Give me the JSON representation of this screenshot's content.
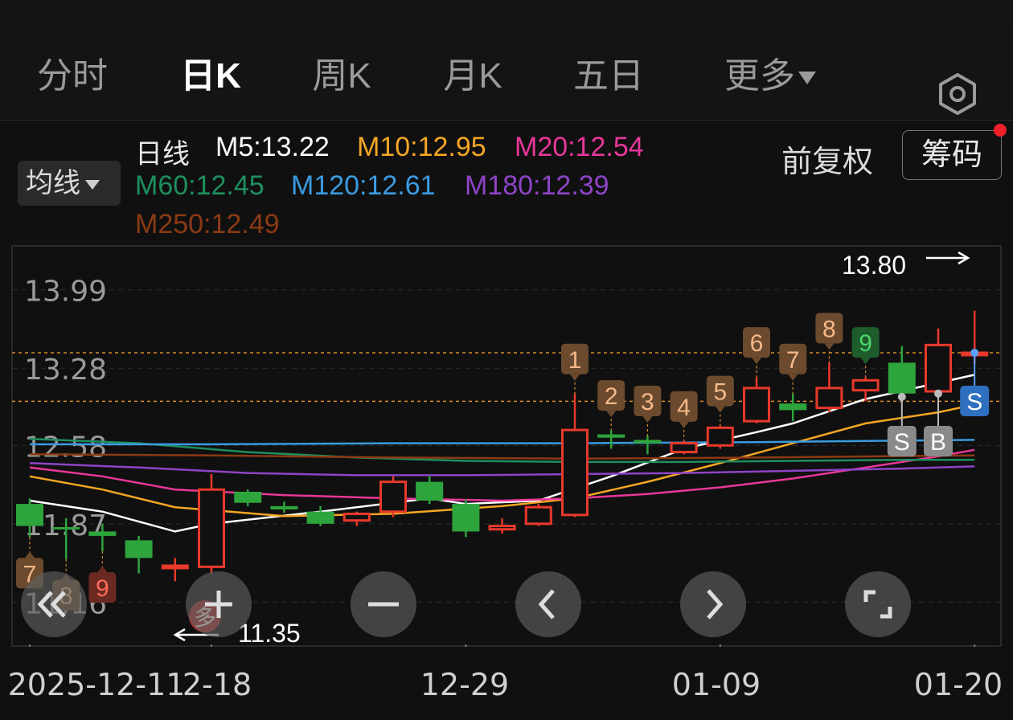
{
  "tabs": [
    {
      "label": "分时",
      "active": false
    },
    {
      "label": "日K",
      "active": true
    },
    {
      "label": "周K",
      "active": false
    },
    {
      "label": "月K",
      "active": false
    },
    {
      "label": "五日",
      "active": false
    },
    {
      "label": "更多",
      "active": false
    }
  ],
  "header": {
    "ma_button": "均线",
    "line_type": "日线",
    "adjust": "前复权",
    "chip_button": "筹码"
  },
  "ma_legend": [
    {
      "label": "M5:13.22",
      "color": "#ffffff"
    },
    {
      "label": "M10:12.95",
      "color": "#f5a623"
    },
    {
      "label": "M20:12.54",
      "color": "#e8379a"
    },
    {
      "label": "M60:12.45",
      "color": "#1e8f5e"
    },
    {
      "label": "M120:12.61",
      "color": "#3a9be0"
    },
    {
      "label": "M180:12.39",
      "color": "#8e44c6"
    },
    {
      "label": "M250:12.49",
      "color": "#8b3a14"
    }
  ],
  "colors": {
    "up": "#e8392b",
    "down": "#2ea43d",
    "bg": "#101010"
  },
  "chart_data": {
    "type": "candlestick",
    "ylim": [
      10.9,
      14.25
    ],
    "y_ticks": [
      "13.99",
      "13.28",
      "12.58",
      "11.87",
      "11.16"
    ],
    "x_labels": [
      {
        "label": "2025-12-11",
        "index": 0
      },
      {
        "label": "2-18",
        "index": 5
      },
      {
        "label": "12-29",
        "index": 12
      },
      {
        "label": "01-09",
        "index": 19
      },
      {
        "label": "01-20",
        "index": 26
      }
    ],
    "high_label": "13.80",
    "low_label": "11.35",
    "reference_lines": [
      13.42,
      12.98
    ],
    "candles": [
      {
        "o": 12.05,
        "h": 12.1,
        "l": 11.75,
        "c": 11.85
      },
      {
        "o": 11.84,
        "h": 11.92,
        "l": 11.55,
        "c": 11.82
      },
      {
        "o": 11.8,
        "h": 11.87,
        "l": 11.62,
        "c": 11.76
      },
      {
        "o": 11.72,
        "h": 11.76,
        "l": 11.42,
        "c": 11.56
      },
      {
        "o": 11.48,
        "h": 11.56,
        "l": 11.35,
        "c": 11.49
      },
      {
        "o": 11.48,
        "h": 12.32,
        "l": 11.42,
        "c": 12.18
      },
      {
        "o": 12.16,
        "h": 12.18,
        "l": 12.03,
        "c": 12.06
      },
      {
        "o": 12.03,
        "h": 12.07,
        "l": 11.97,
        "c": 12.0
      },
      {
        "o": 11.98,
        "h": 12.03,
        "l": 11.85,
        "c": 11.87
      },
      {
        "o": 11.9,
        "h": 11.98,
        "l": 11.85,
        "c": 11.96
      },
      {
        "o": 11.98,
        "h": 12.3,
        "l": 11.93,
        "c": 12.25
      },
      {
        "o": 12.25,
        "h": 12.3,
        "l": 12.05,
        "c": 12.08
      },
      {
        "o": 12.05,
        "h": 12.09,
        "l": 11.75,
        "c": 11.8
      },
      {
        "o": 11.82,
        "h": 11.92,
        "l": 11.78,
        "c": 11.85
      },
      {
        "o": 11.87,
        "h": 12.05,
        "l": 11.85,
        "c": 12.02
      },
      {
        "o": 11.95,
        "h": 13.05,
        "l": 11.93,
        "c": 12.72
      },
      {
        "o": 12.68,
        "h": 12.72,
        "l": 12.55,
        "c": 12.65
      },
      {
        "o": 12.63,
        "h": 12.67,
        "l": 12.5,
        "c": 12.6
      },
      {
        "o": 12.52,
        "h": 12.62,
        "l": 12.5,
        "c": 12.6
      },
      {
        "o": 12.58,
        "h": 12.76,
        "l": 12.55,
        "c": 12.74
      },
      {
        "o": 12.8,
        "h": 13.2,
        "l": 12.78,
        "c": 13.1
      },
      {
        "o": 12.96,
        "h": 13.05,
        "l": 12.8,
        "c": 12.9
      },
      {
        "o": 12.92,
        "h": 13.33,
        "l": 12.88,
        "c": 13.1
      },
      {
        "o": 13.08,
        "h": 13.2,
        "l": 12.98,
        "c": 13.17
      },
      {
        "o": 13.33,
        "h": 13.48,
        "l": 13.02,
        "c": 13.05
      },
      {
        "o": 13.07,
        "h": 13.64,
        "l": 13.05,
        "c": 13.49
      },
      {
        "o": 13.42,
        "h": 13.8,
        "l": 13.32,
        "c": 13.42
      }
    ],
    "ma": [
      {
        "name": "M5",
        "color": "#ffffff",
        "points": [
          [
            0,
            12.08
          ],
          [
            2,
            11.98
          ],
          [
            4,
            11.8
          ],
          [
            5,
            11.87
          ],
          [
            8,
            11.98
          ],
          [
            11,
            12.1
          ],
          [
            12,
            12.05
          ],
          [
            14,
            12.08
          ],
          [
            16,
            12.3
          ],
          [
            18,
            12.55
          ],
          [
            20,
            12.7
          ],
          [
            21,
            12.78
          ],
          [
            23,
            13.0
          ],
          [
            26,
            13.22
          ]
        ]
      },
      {
        "name": "M10",
        "color": "#f5a623",
        "points": [
          [
            0,
            12.3
          ],
          [
            2,
            12.18
          ],
          [
            4,
            12.02
          ],
          [
            7,
            11.94
          ],
          [
            10,
            11.96
          ],
          [
            13,
            12.03
          ],
          [
            15,
            12.1
          ],
          [
            17,
            12.25
          ],
          [
            19,
            12.42
          ],
          [
            21,
            12.6
          ],
          [
            23,
            12.78
          ],
          [
            25,
            12.88
          ],
          [
            26,
            12.95
          ]
        ]
      },
      {
        "name": "M20",
        "color": "#e8379a",
        "points": [
          [
            0,
            12.38
          ],
          [
            2,
            12.3
          ],
          [
            4,
            12.18
          ],
          [
            7,
            12.13
          ],
          [
            10,
            12.1
          ],
          [
            13,
            12.08
          ],
          [
            15,
            12.1
          ],
          [
            17,
            12.14
          ],
          [
            19,
            12.2
          ],
          [
            21,
            12.28
          ],
          [
            23,
            12.38
          ],
          [
            25,
            12.48
          ],
          [
            26,
            12.54
          ]
        ]
      },
      {
        "name": "M60",
        "color": "#1e8f5e",
        "points": [
          [
            0,
            12.64
          ],
          [
            3,
            12.6
          ],
          [
            6,
            12.52
          ],
          [
            9,
            12.47
          ],
          [
            12,
            12.44
          ],
          [
            15,
            12.43
          ],
          [
            18,
            12.43
          ],
          [
            21,
            12.44
          ],
          [
            24,
            12.45
          ],
          [
            26,
            12.45
          ]
        ]
      },
      {
        "name": "M120",
        "color": "#3a9be0",
        "points": [
          [
            0,
            12.59
          ],
          [
            5,
            12.59
          ],
          [
            10,
            12.6
          ],
          [
            15,
            12.6
          ],
          [
            20,
            12.61
          ],
          [
            26,
            12.63
          ]
        ]
      },
      {
        "name": "M180",
        "color": "#8e44c6",
        "points": [
          [
            0,
            12.42
          ],
          [
            3,
            12.38
          ],
          [
            6,
            12.33
          ],
          [
            9,
            12.31
          ],
          [
            12,
            12.31
          ],
          [
            15,
            12.32
          ],
          [
            18,
            12.33
          ],
          [
            21,
            12.35
          ],
          [
            24,
            12.37
          ],
          [
            26,
            12.39
          ]
        ]
      },
      {
        "name": "M250",
        "color": "#8b3a14",
        "points": [
          [
            0,
            12.5
          ],
          [
            5,
            12.49
          ],
          [
            10,
            12.47
          ],
          [
            15,
            12.46
          ],
          [
            20,
            12.47
          ],
          [
            26,
            12.49
          ]
        ]
      }
    ],
    "seq_markers": [
      {
        "i": 0,
        "label": "7",
        "above": false,
        "kind": "low"
      },
      {
        "i": 1,
        "label": "8",
        "above": false,
        "kind": "low"
      },
      {
        "i": 2,
        "label": "9",
        "above": false,
        "kind": "low9"
      },
      {
        "i": 15,
        "label": "1",
        "above": true,
        "kind": "high"
      },
      {
        "i": 16,
        "label": "2",
        "above": true,
        "kind": "high"
      },
      {
        "i": 17,
        "label": "3",
        "above": true,
        "kind": "high"
      },
      {
        "i": 18,
        "label": "4",
        "above": true,
        "kind": "high"
      },
      {
        "i": 19,
        "label": "5",
        "above": true,
        "kind": "high"
      },
      {
        "i": 20,
        "label": "6",
        "above": true,
        "kind": "high"
      },
      {
        "i": 21,
        "label": "7",
        "above": true,
        "kind": "high"
      },
      {
        "i": 22,
        "label": "8",
        "above": true,
        "kind": "high"
      },
      {
        "i": 23,
        "label": "9",
        "above": true,
        "kind": "high9"
      }
    ],
    "signals": [
      {
        "i": 24,
        "label": "S",
        "kind": "gray"
      },
      {
        "i": 25,
        "label": "B",
        "kind": "gray"
      },
      {
        "i": 26,
        "label": "S",
        "kind": "blue"
      },
      {
        "i": 5,
        "label": "多",
        "kind": "red"
      }
    ]
  }
}
